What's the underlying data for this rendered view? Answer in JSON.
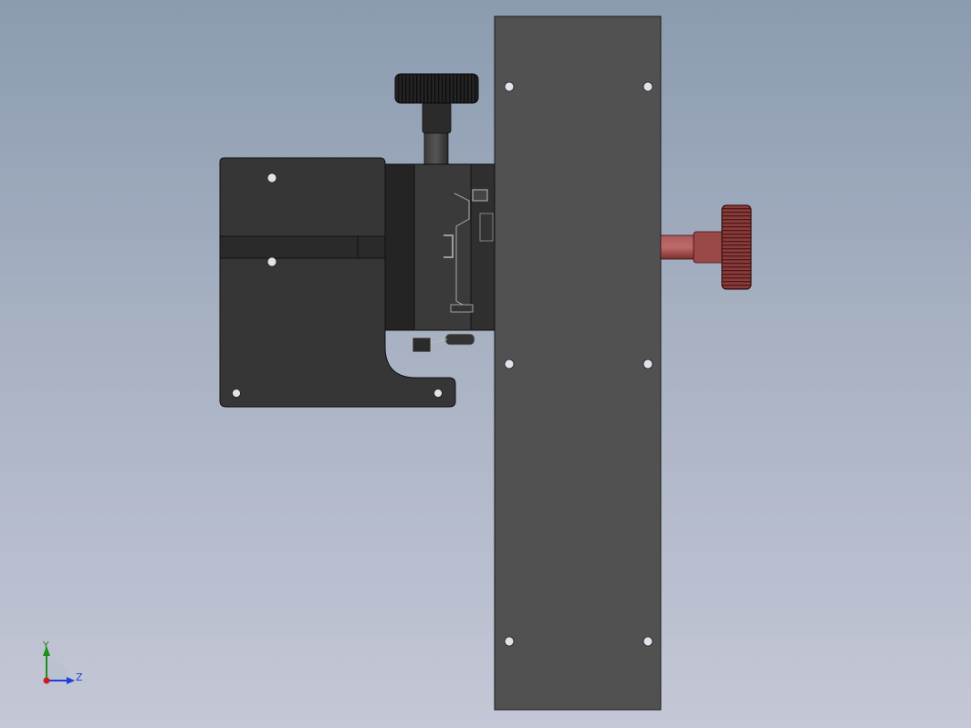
{
  "triad": {
    "y_label": "Y",
    "z_label": "Z",
    "y_color": "#1a8f1a",
    "z_color": "#1f3fd6",
    "x_color": "#c81e1e"
  },
  "colors": {
    "plate": "#515151",
    "body": "#2e2e2e",
    "bracket": "#383838",
    "knob_dark": "#1f1f1f",
    "knob_red": "#8c3b3b",
    "hole": "#dfe3ea"
  }
}
